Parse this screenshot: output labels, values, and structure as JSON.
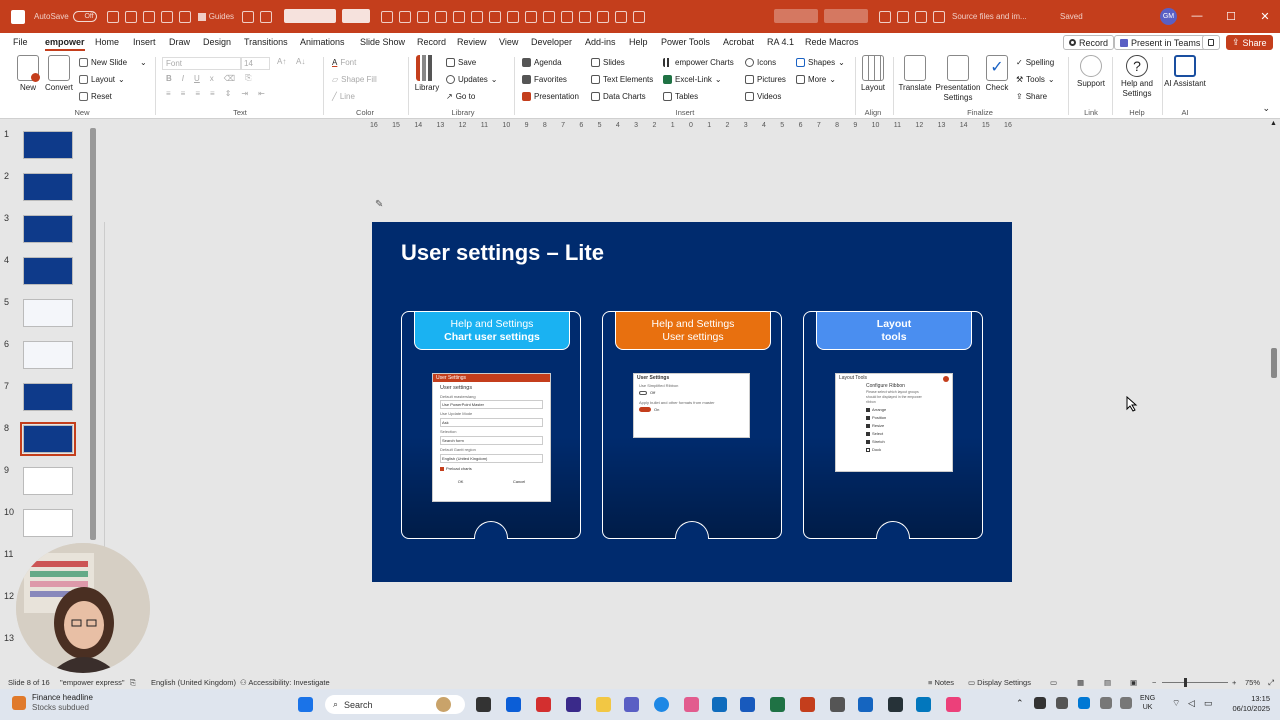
{
  "app": {
    "autosave_label": "AutoSave",
    "autosave_state": "Off",
    "guides_label": "Guides",
    "size_width": "17.98 cm",
    "size_height": "10.2 cm",
    "search_hint": "Source files and im...",
    "saved_status": "Saved",
    "user_initials": "GM"
  },
  "menu": {
    "tabs": [
      "File",
      "empower",
      "Home",
      "Insert",
      "Draw",
      "Design",
      "Transitions",
      "Animations",
      "Slide Show",
      "Record",
      "Review",
      "View",
      "Developer",
      "Add-ins",
      "Help",
      "Power Tools",
      "Acrobat",
      "RA 4.1",
      "Rede Macros"
    ],
    "active_tab": "empower",
    "record_label": "Record",
    "present_label": "Present in Teams",
    "share_label": "Share"
  },
  "ribbon": {
    "new_label": "New",
    "convert_label": "Convert",
    "new_slide": "New Slide",
    "layout": "Layout",
    "reset": "Reset",
    "group_new": "New",
    "font_placeholder": "Font",
    "font_size": "14",
    "group_text": "Text",
    "fill_label": "Fill",
    "shape_fill": "Shape Fill",
    "line_label": "Line",
    "group_color": "Color",
    "library": "Library",
    "save": "Save",
    "updates": "Updates",
    "goto": "Go to",
    "group_library": "Library",
    "agenda": "Agenda",
    "favorites": "Favorites",
    "presentation": "Presentation",
    "slides": "Slides",
    "text_elements": "Text Elements",
    "data_charts": "Data Charts",
    "empower_charts": "empower Charts",
    "excel_link": "Excel-Link",
    "tables": "Tables",
    "icons": "Icons",
    "pictures": "Pictures",
    "videos": "Videos",
    "shapes": "Shapes",
    "more": "More",
    "group_insert": "Insert",
    "layout_big": "Layout",
    "group_align": "Align",
    "translate": "Translate",
    "presentation_settings": "Presentation Settings",
    "check": "Check",
    "spelling": "Spelling",
    "tools": "Tools",
    "share": "Share",
    "group_finalize": "Finalize",
    "support": "Support",
    "group_link": "Link",
    "help_settings": "Help and Settings",
    "group_help": "Help",
    "ai_assistant": "AI Assistant",
    "group_ai": "AI"
  },
  "ruler": {
    "ticks": [
      "16",
      "15",
      "14",
      "13",
      "12",
      "11",
      "10",
      "9",
      "8",
      "7",
      "6",
      "5",
      "4",
      "3",
      "2",
      "1",
      "0",
      "1",
      "2",
      "3",
      "4",
      "5",
      "6",
      "7",
      "8",
      "9",
      "10",
      "11",
      "12",
      "13",
      "14",
      "15",
      "16"
    ]
  },
  "thumbnails": {
    "numbers": [
      "1",
      "2",
      "3",
      "4",
      "5",
      "6",
      "7",
      "8",
      "9",
      "10",
      "11",
      "12",
      "13"
    ],
    "selected": "8"
  },
  "slide": {
    "title": "User settings – Lite",
    "cards": [
      {
        "line1": "Help and Settings",
        "line2": "Chart user settings",
        "color": "#1ab2f2"
      },
      {
        "line1": "Help and Settings",
        "line2": "User settings",
        "color": "#e8700f"
      },
      {
        "line1": "Layout",
        "line2": "tools",
        "color": "#4a8ef0"
      }
    ],
    "shot1": {
      "title": "User Settings",
      "heading": "User settings",
      "f1": "Default masterslang",
      "v1": "Use PowerPoint Master",
      "f2": "Use Update Mode",
      "v2": "Ask",
      "f3": "Selection",
      "v3": "Search form",
      "f4": "Default Gantt region",
      "v4": "English (United Kingdom)",
      "check": "Preload charts",
      "ok": "OK",
      "cancel": "Cancel"
    },
    "shot2": {
      "title": "User Settings",
      "opt1": "Use Simplified Ribbon",
      "off": "Off",
      "opt2": "Apply bullet and other formats from master",
      "on": "On"
    },
    "shot3": {
      "title": "Layout Tools",
      "heading": "Configure Ribbon",
      "desc": "Please select which layout groups should be displayed in the empower ribbon",
      "items": [
        "Arrange",
        "Position",
        "Resize",
        "Select",
        "Stretch",
        "Dock"
      ]
    }
  },
  "status": {
    "slide_of": "Slide 8 of 16",
    "theme": "\"empower express\"",
    "language": "English (United Kingdom)",
    "accessibility": "Accessibility: Investigate",
    "notes": "Notes",
    "display": "Display Settings",
    "zoom": "75%"
  },
  "taskbar": {
    "weather_title": "Finance headline",
    "weather_sub": "Stocks subdued",
    "search": "Search",
    "lang1": "ENG",
    "lang2": "UK",
    "time": "13:15",
    "date": "06/10/2025"
  },
  "colors": {
    "accent": "#c43e1c",
    "slide_bg": "#002b6e"
  }
}
